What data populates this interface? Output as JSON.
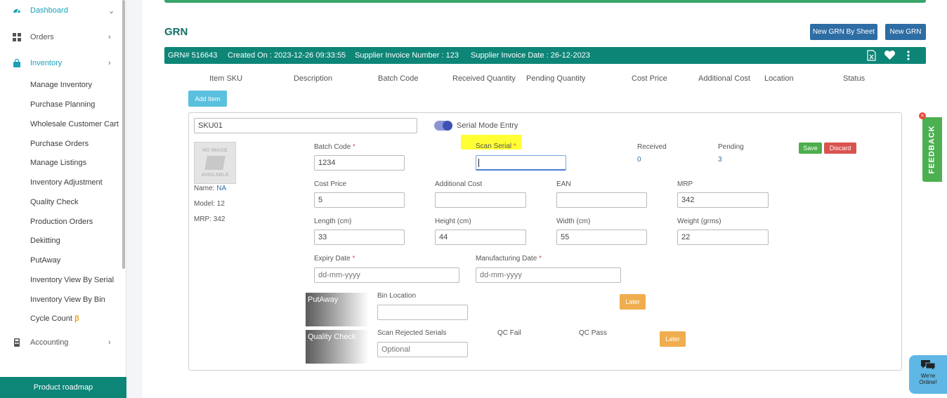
{
  "sidebar": {
    "dashboard": "Dashboard",
    "orders": "Orders",
    "inventory": "Inventory",
    "accounting": "Accounting",
    "sub_items": [
      "Manage Inventory",
      "Purchase Planning",
      "Wholesale Customer Cart",
      "Purchase Orders",
      "Manage Listings",
      "Inventory Adjustment",
      "Quality Check",
      "Production Orders",
      "Dekitting",
      "PutAway",
      "Inventory View By Serial",
      "Inventory View By Bin",
      "Cycle Count"
    ],
    "beta": "β",
    "roadmap": "Product roadmap",
    "accent_color": "#17a2b8"
  },
  "header": {
    "title": "GRN",
    "new_by_sheet": "New GRN By Sheet",
    "new_grn": "New GRN"
  },
  "grn_bar": {
    "grn_no": "GRN# 516643",
    "created": "Created On : 2023-12-26 09:33:55",
    "invoice_no": "Supplier Invoice Number : 123",
    "invoice_date": "Supplier Invoice Date : 26-12-2023",
    "bar_color": "#0d8577"
  },
  "columns": [
    "Item SKU",
    "Description",
    "Batch Code",
    "Received Quantity",
    "Pending Quantity",
    "Cost Price",
    "Additional Cost",
    "Location",
    "Status"
  ],
  "add_item": "Add Item",
  "item": {
    "sku": "SKU01",
    "serial_mode_label": "Serial Mode Entry",
    "no_image_1": "NO IMAGE",
    "no_image_2": "AVAILABLE",
    "name_label": "Name:",
    "name_value": "NA",
    "model": "Model: 12",
    "mrp_text": "MRP: 342",
    "batch_code_label": "Batch Code",
    "batch_code": "1234",
    "scan_serial_label": "Scan Serial",
    "scan_serial": "",
    "received_label": "Received",
    "received": "0",
    "pending_label": "Pending",
    "pending": "3",
    "save": "Save",
    "discard": "Discard",
    "cost_price_label": "Cost Price",
    "cost_price": "5",
    "additional_cost_label": "Additional Cost",
    "additional_cost": "",
    "ean_label": "EAN",
    "ean": "",
    "mrp_label": "MRP",
    "mrp": "342",
    "length_label": "Length (cm)",
    "length": "33",
    "height_label": "Height (cm)",
    "height": "44",
    "width_label": "Width (cm)",
    "width": "55",
    "weight_label": "Weight (grms)",
    "weight": "22",
    "expiry_label": "Expiry Date",
    "expiry_placeholder": "dd-mm-yyyy",
    "mfg_label": "Manufacturing Date",
    "mfg_placeholder": "dd-mm-yyyy",
    "req": "*"
  },
  "putaway": {
    "title": "PutAway",
    "bin_label": "Bin Location",
    "bin": "",
    "later": "Later"
  },
  "qc": {
    "title": "Quality Check",
    "scan_rejected_label": "Scan Rejected Serials",
    "scan_rejected_placeholder": "Optional",
    "fail": "QC Fail",
    "pass": "QC Pass",
    "later": "Later"
  },
  "feedback": "FEEDBACK",
  "feedback_close": "×",
  "chat": {
    "line1": "We're",
    "line2": "Online!"
  }
}
